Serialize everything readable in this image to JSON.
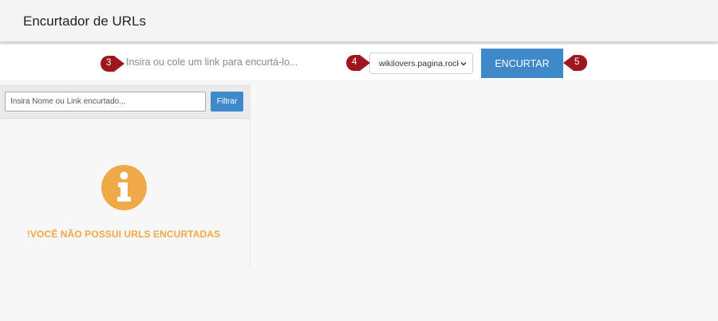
{
  "header": {
    "title": "Encurtador de URLs"
  },
  "shortener": {
    "url_placeholder": "Insira ou cole um link para encurtá-lo...",
    "domain_selected": "wikilovers.pagina.rocks",
    "submit_label": "ENCURTAR"
  },
  "markers": {
    "m3": "3",
    "m4": "4",
    "m5": "5"
  },
  "sidebar": {
    "filter_placeholder": "Insira Nome ou Link encurtado...",
    "filter_label": "Filtrar",
    "empty_message": "!VOCÊ NÃO POSSUI URLS ENCURTADAS"
  },
  "colors": {
    "accent": "#3f88c9",
    "warning": "#efaa47",
    "marker": "#a0161d"
  },
  "icons": {
    "info": "info-icon",
    "chevron": "chevron-down-icon"
  }
}
